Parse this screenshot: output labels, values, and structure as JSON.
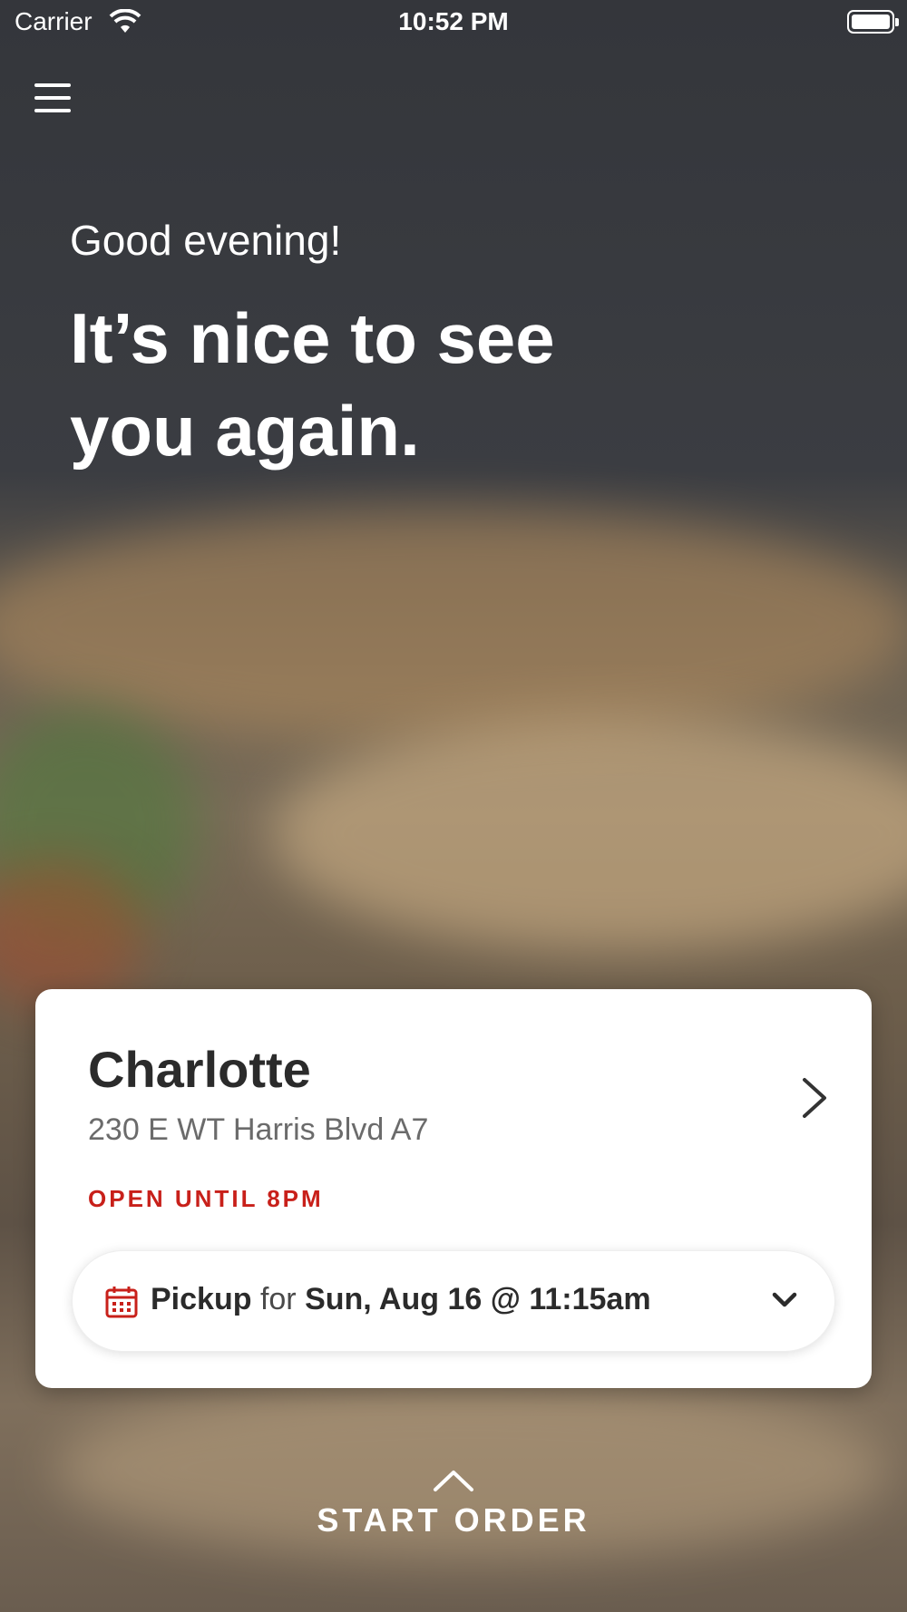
{
  "status_bar": {
    "carrier": "Carrier",
    "time": "10:52 PM"
  },
  "header": {
    "menu_icon": "hamburger-menu-icon"
  },
  "hero": {
    "greeting": "Good evening!",
    "headline": "It’s nice to see you again."
  },
  "location_card": {
    "title": "Charlotte",
    "address": "230 E WT Harris Blvd A7",
    "hours": "OPEN UNTIL 8PM",
    "hours_color": "#c8201a",
    "chevron_icon": "chevron-right-icon",
    "pickup": {
      "icon": "calendar-icon",
      "mode": "Pickup",
      "connector": "for",
      "datetime": "Sun, Aug 16 @ 11:15am",
      "dropdown_icon": "chevron-down-icon"
    }
  },
  "footer": {
    "start_order_label": "START ORDER",
    "up_icon": "chevron-up-icon"
  }
}
